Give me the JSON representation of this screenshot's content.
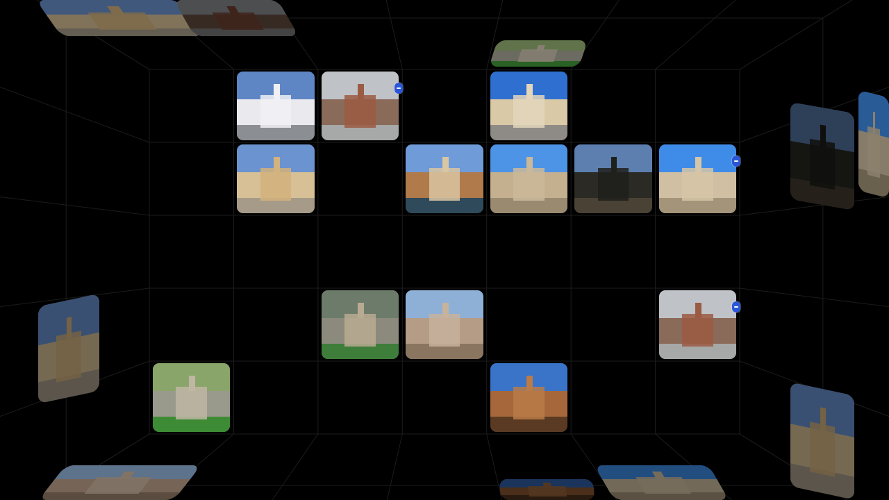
{
  "palette": {
    "background": "#000000",
    "grid_line": "#1c1c1c",
    "badge": "#2a56d8"
  },
  "view": {
    "projection": "inside-cube",
    "back_wall_columns": 7,
    "back_wall_rows": 5
  },
  "photo_scenes": {
    "cityhall": {
      "sky": "#5f86c4",
      "mid": "#e9e9ee",
      "ground": "#8b8e93",
      "building": "#f0f0f4"
    },
    "avenue": {
      "sky": "#bfc3c8",
      "mid": "#8a6a58",
      "ground": "#a7a8a8",
      "building": "#9b5b43"
    },
    "monument": {
      "sky": "#2f6fd0",
      "mid": "#d9c9a6",
      "ground": "#8e8a86",
      "building": "#e3d6bb"
    },
    "carriage_street": {
      "sky": "#6b93cf",
      "mid": "#d8c096",
      "ground": "#a69b89",
      "building": "#d2b27d"
    },
    "fountain_park": {
      "sky": "#6f9bd8",
      "mid": "#b07a4a",
      "ground": "#2f4a5a",
      "building": "#d9c6a2"
    },
    "cathedral": {
      "sky": "#4d94e6",
      "mid": "#c4b08f",
      "ground": "#9a8a70",
      "building": "#cbb89a"
    },
    "skyline_silhouette": {
      "sky": "#5c7fb0",
      "mid": "#2b2a24",
      "ground": "#4a4234",
      "building": "#1f1f1b"
    },
    "cathedral_bright": {
      "sky": "#3f8ce8",
      "mid": "#d0bfa2",
      "ground": "#a49479",
      "building": "#d6c5a7"
    },
    "aerial_gardens": {
      "sky": "#6d7c6a",
      "mid": "#8b8a7c",
      "ground": "#3f7d3a",
      "building": "#b9aa92"
    },
    "aerial_city": {
      "sky": "#8fb0d6",
      "mid": "#b59c86",
      "ground": "#8a7560",
      "building": "#c7b29c"
    },
    "palace_arcade": {
      "sky": "#3a74c9",
      "mid": "#a6683a",
      "ground": "#5a3a22",
      "building": "#b97b48"
    },
    "aerial_green": {
      "sky": "#8aa56a",
      "mid": "#9a9a8c",
      "ground": "#3d8b34",
      "building": "#c0b6a4"
    }
  },
  "back_wall_photos": [
    {
      "col": 1,
      "row": 0,
      "scene": "cityhall",
      "badge": false
    },
    {
      "col": 2,
      "row": 0,
      "scene": "avenue",
      "badge": true
    },
    {
      "col": 4,
      "row": 0,
      "scene": "monument",
      "badge": false
    },
    {
      "col": 1,
      "row": 1,
      "scene": "carriage_street",
      "badge": false
    },
    {
      "col": 3,
      "row": 1,
      "scene": "fountain_park",
      "badge": false
    },
    {
      "col": 4,
      "row": 1,
      "scene": "cathedral",
      "badge": false
    },
    {
      "col": 5,
      "row": 1,
      "scene": "skyline_silhouette",
      "badge": false
    },
    {
      "col": 6,
      "row": 1,
      "scene": "cathedral_bright",
      "badge": true
    },
    {
      "col": 2,
      "row": 3,
      "scene": "aerial_gardens",
      "badge": false
    },
    {
      "col": 3,
      "row": 3,
      "scene": "aerial_city",
      "badge": false
    },
    {
      "col": 6,
      "row": 3,
      "scene": "avenue",
      "badge": true
    },
    {
      "col": 0,
      "row": 4,
      "scene": "aerial_green",
      "badge": false
    },
    {
      "col": 4,
      "row": 4,
      "scene": "palace_arcade",
      "badge": false
    }
  ],
  "side_wall_photos": [
    {
      "wall": "left",
      "slot": 2,
      "scene": "carriage_street",
      "dim": 0.45
    },
    {
      "wall": "right",
      "slot": 0,
      "scene": "skyline_silhouette",
      "dim": 0.5
    },
    {
      "wall": "right",
      "slot": 1,
      "scene": "cathedral_bright",
      "dim": 0.35
    },
    {
      "wall": "right",
      "slot": 2,
      "scene": "carriage_street",
      "dim": 0.45
    },
    {
      "wall": "ceiling",
      "slot": 0,
      "scene": "carriage_street",
      "dim": 0.4
    },
    {
      "wall": "ceiling",
      "slot": 1,
      "scene": "avenue",
      "dim": 0.6
    },
    {
      "wall": "ceiling",
      "slot": 3,
      "scene": "aerial_green",
      "dim": 0.3
    },
    {
      "wall": "floor",
      "slot": 0,
      "scene": "aerial_city",
      "dim": 0.35
    },
    {
      "wall": "floor",
      "slot": 3,
      "scene": "palace_arcade",
      "dim": 0.55
    },
    {
      "wall": "floor",
      "slot": 4,
      "scene": "cathedral_bright",
      "dim": 0.45
    }
  ]
}
